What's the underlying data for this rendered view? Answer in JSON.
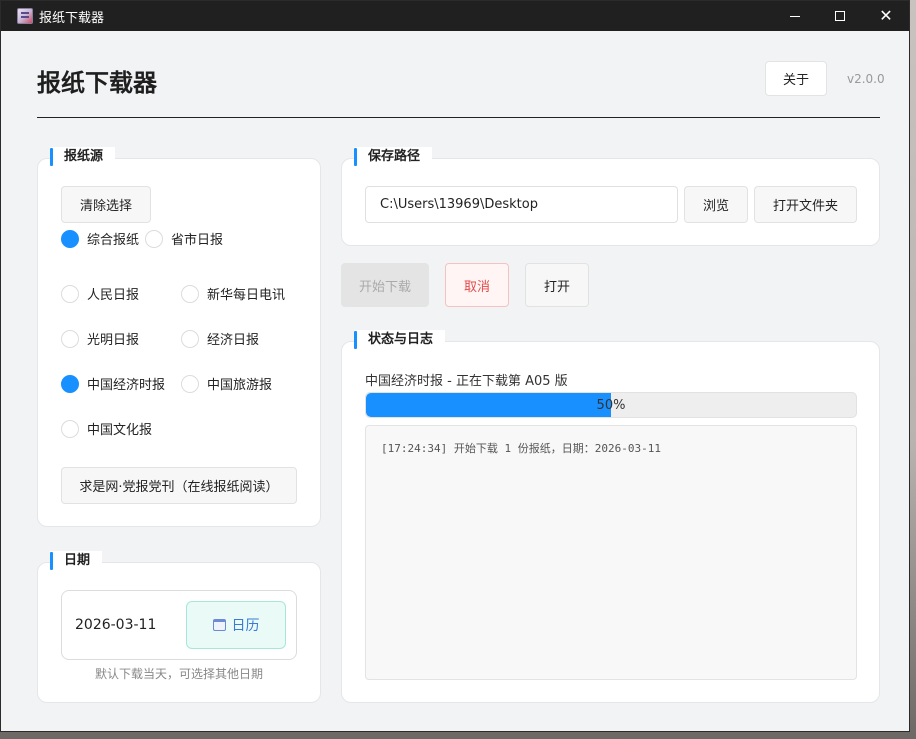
{
  "window": {
    "title": "报纸下载器",
    "controls": {
      "minimize_icon": "minimize-icon",
      "maximize_icon": "maximize-icon",
      "close_icon": "close-icon"
    }
  },
  "header": {
    "title": "报纸下载器",
    "about_label": "关于",
    "version": "v2.0.0"
  },
  "source": {
    "section_title": "报纸源",
    "clear_label": "清除选择",
    "categories": [
      {
        "label": "综合报纸",
        "checked": true
      },
      {
        "label": "省市日报",
        "checked": false
      }
    ],
    "papers": [
      {
        "label": "人民日报",
        "checked": false
      },
      {
        "label": "新华每日电讯",
        "checked": false
      },
      {
        "label": "光明日报",
        "checked": false
      },
      {
        "label": "经济日报",
        "checked": false
      },
      {
        "label": "中国经济时报",
        "checked": true
      },
      {
        "label": "中国旅游报",
        "checked": false
      },
      {
        "label": "中国文化报",
        "checked": false
      }
    ],
    "online_label": "求是网·党报党刊（在线报纸阅读）"
  },
  "date": {
    "section_title": "日期",
    "value": "2026-03-11",
    "calendar_label": "日历",
    "hint": "默认下载当天，可选择其他日期"
  },
  "save_path": {
    "section_title": "保存路径",
    "value": "C:\\Users\\13969\\Desktop",
    "browse_label": "浏览",
    "open_folder_label": "打开文件夹"
  },
  "actions": {
    "start_label": "开始下载",
    "cancel_label": "取消",
    "open_label": "打开"
  },
  "status": {
    "section_title": "状态与日志",
    "message": "中国经济时报 - 正在下载第 A05 版",
    "progress": 0.5,
    "progress_label": "50%",
    "log_lines": [
      "[17:24:34] 开始下载 1 份报纸，日期：2026-03-11"
    ]
  },
  "colors": {
    "accent": "#1890ff",
    "cancel": "#e24b4b",
    "calendar_bg": "#eafaf7"
  }
}
